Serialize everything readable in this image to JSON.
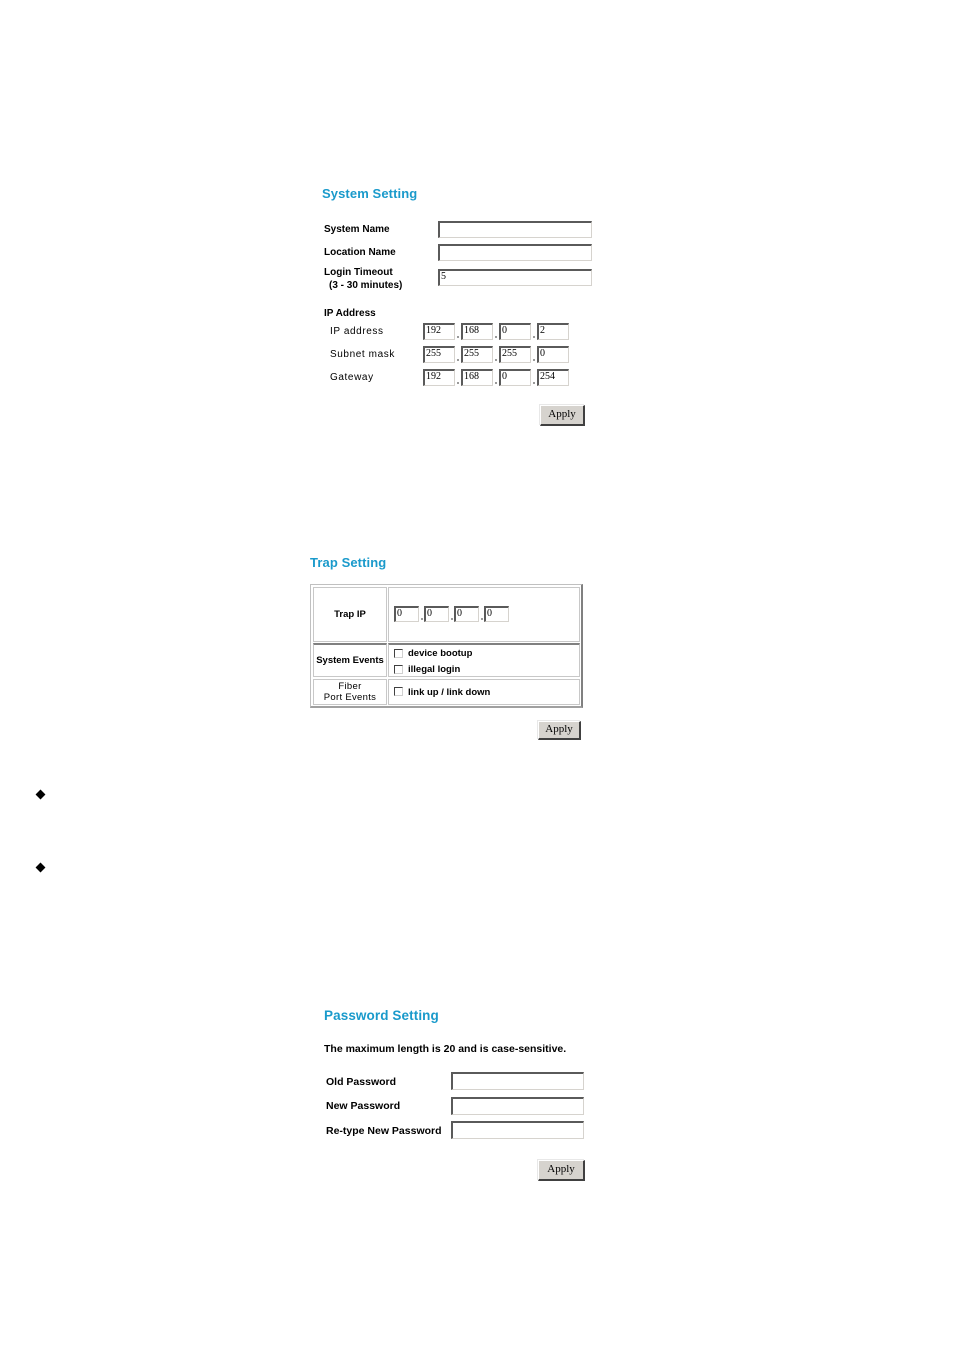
{
  "system_setting": {
    "title": "System Setting",
    "fields": {
      "system_name": {
        "label": "System Name",
        "value": ""
      },
      "location_name": {
        "label": "Location Name",
        "value": ""
      },
      "login_timeout": {
        "label": "Login Timeout",
        "sublabel": "(3 - 30 minutes)",
        "value": "5"
      }
    },
    "ip_section": {
      "heading": "IP Address",
      "rows": [
        {
          "label": "IP address",
          "octets": [
            "192",
            "168",
            "0",
            "2"
          ]
        },
        {
          "label": "Subnet mask",
          "octets": [
            "255",
            "255",
            "255",
            "0"
          ]
        },
        {
          "label": "Gateway",
          "octets": [
            "192",
            "168",
            "0",
            "254"
          ]
        }
      ]
    },
    "apply_label": "Apply"
  },
  "trap_setting": {
    "title": "Trap Setting",
    "trap_ip": {
      "label": "Trap IP",
      "octets": [
        "0",
        "0",
        "0",
        "0"
      ]
    },
    "system_events": {
      "label": "System Events",
      "options": [
        {
          "label": "device bootup",
          "checked": false
        },
        {
          "label": "illegal login",
          "checked": false
        }
      ]
    },
    "fiber_port_events": {
      "label_line1": "Fiber",
      "label_line2": "Port Events",
      "options": [
        {
          "label": "link up / link down",
          "checked": false
        }
      ]
    },
    "apply_label": "Apply"
  },
  "bullets": [
    {
      "icon": "diamond-bullet-icon",
      "text": ""
    },
    {
      "icon": "diamond-bullet-icon",
      "text": ""
    }
  ],
  "password_setting": {
    "title": "Password Setting",
    "note": "The maximum length is 20 and is case-sensitive.",
    "fields": {
      "old_password": {
        "label": "Old Password",
        "value": ""
      },
      "new_password": {
        "label": "New Password",
        "value": ""
      },
      "retype_password": {
        "label": "Re-type New Password",
        "value": ""
      }
    },
    "apply_label": "Apply"
  },
  "colors": {
    "title_accent": "#1a9acb",
    "button_face": "#d6d3ce"
  }
}
